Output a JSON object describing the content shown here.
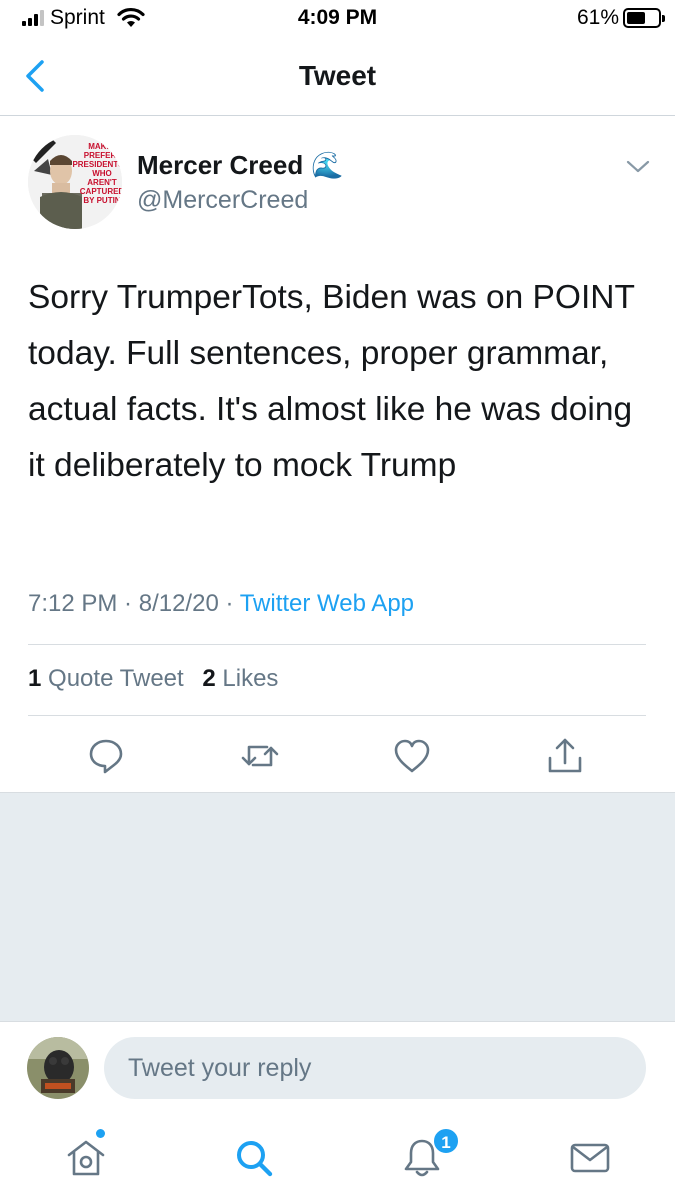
{
  "status_bar": {
    "carrier": "Sprint",
    "time": "4:09 PM",
    "battery_percent": "61%",
    "battery_level": 0.61,
    "signal_bars_filled": 3,
    "signal_bars_total": 4
  },
  "nav": {
    "title": "Tweet",
    "back_icon": "chevron-left-icon"
  },
  "tweet": {
    "display_name": "Mercer Creed",
    "name_emoji": "🌊",
    "handle": "@MercerCreed",
    "avatar_text": [
      "MAKE",
      "PREFER",
      "PRESIDENTS",
      "WHO",
      "AREN'T",
      "CAPTURED",
      "BY PUTIN"
    ],
    "text": "Sorry TrumperTots, Biden was on POINT today. Full sentences, proper grammar, actual facts. It's almost like he was doing it deliberately to mock Trump",
    "time": "7:12 PM",
    "date": "8/12/20",
    "separator": " · ",
    "source": "Twitter Web App",
    "quote_count": "1",
    "quote_label": "Quote Tweet",
    "like_count": "2",
    "like_label": "Likes"
  },
  "actions": [
    "reply-icon",
    "retweet-icon",
    "like-icon",
    "share-icon"
  ],
  "reply": {
    "placeholder": "Tweet your reply"
  },
  "tab_bar": {
    "tabs": [
      "home-icon",
      "search-icon",
      "notifications-icon",
      "messages-icon"
    ],
    "notification_badge": "1",
    "active_tab": "search"
  },
  "colors": {
    "accent": "#1da1f2",
    "text_primary": "#14171a",
    "text_secondary": "#657786",
    "empty_area": "#e6ecf0"
  }
}
